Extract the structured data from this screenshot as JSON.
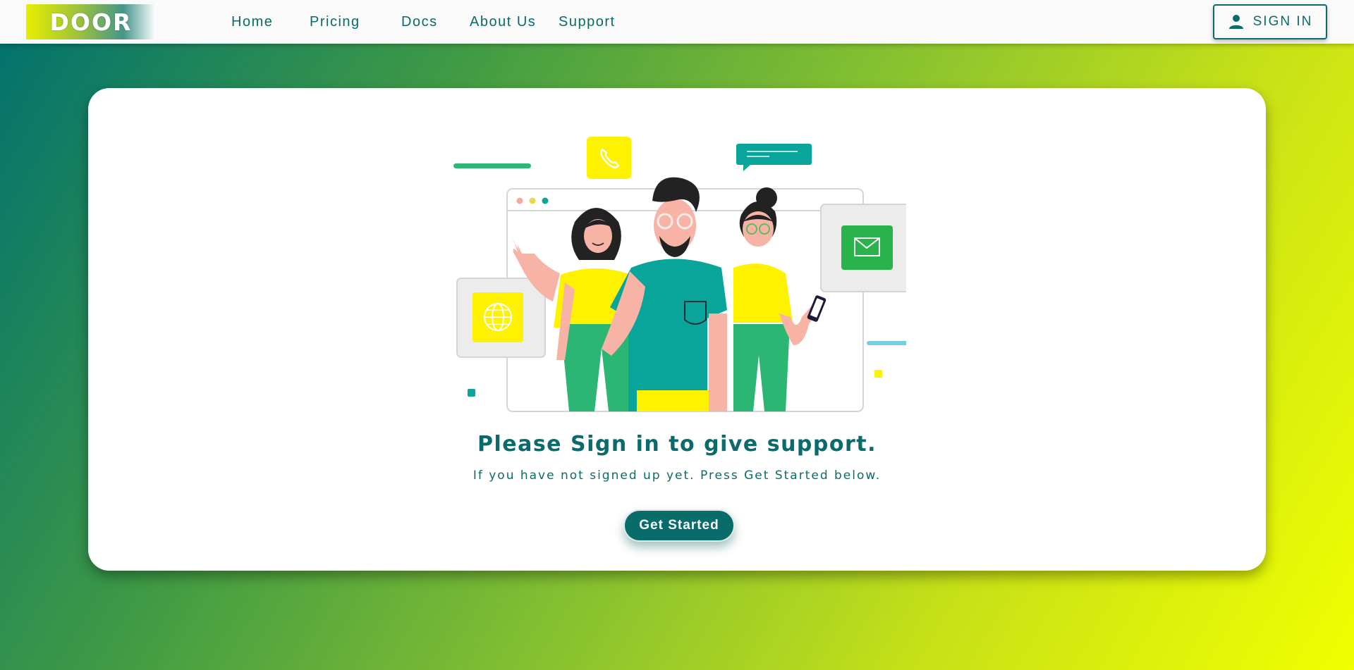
{
  "header": {
    "logo_text": "DOOR",
    "nav": [
      {
        "label": "Home"
      },
      {
        "label": "Pricing"
      },
      {
        "label": "Docs"
      },
      {
        "label": "About Us"
      },
      {
        "label": "Support"
      }
    ],
    "signin": {
      "label": "SIGN IN",
      "icon": "person-icon"
    }
  },
  "main": {
    "headline": "Please Sign in to give support.",
    "subline": "If you have not signed up yet. Press Get Started below.",
    "cta_label": "Get Started",
    "illustration_icons": [
      "phone-icon",
      "chat-bubble-icon",
      "mail-icon",
      "globe-icon",
      "smartphone-icon"
    ]
  },
  "colors": {
    "primary": "#0b6b6c",
    "accent_yellow": "#fff200",
    "accent_green": "#2ab56a",
    "teal": "#0aa59a",
    "background_start": "#00706f",
    "background_end": "#f2ff00"
  }
}
